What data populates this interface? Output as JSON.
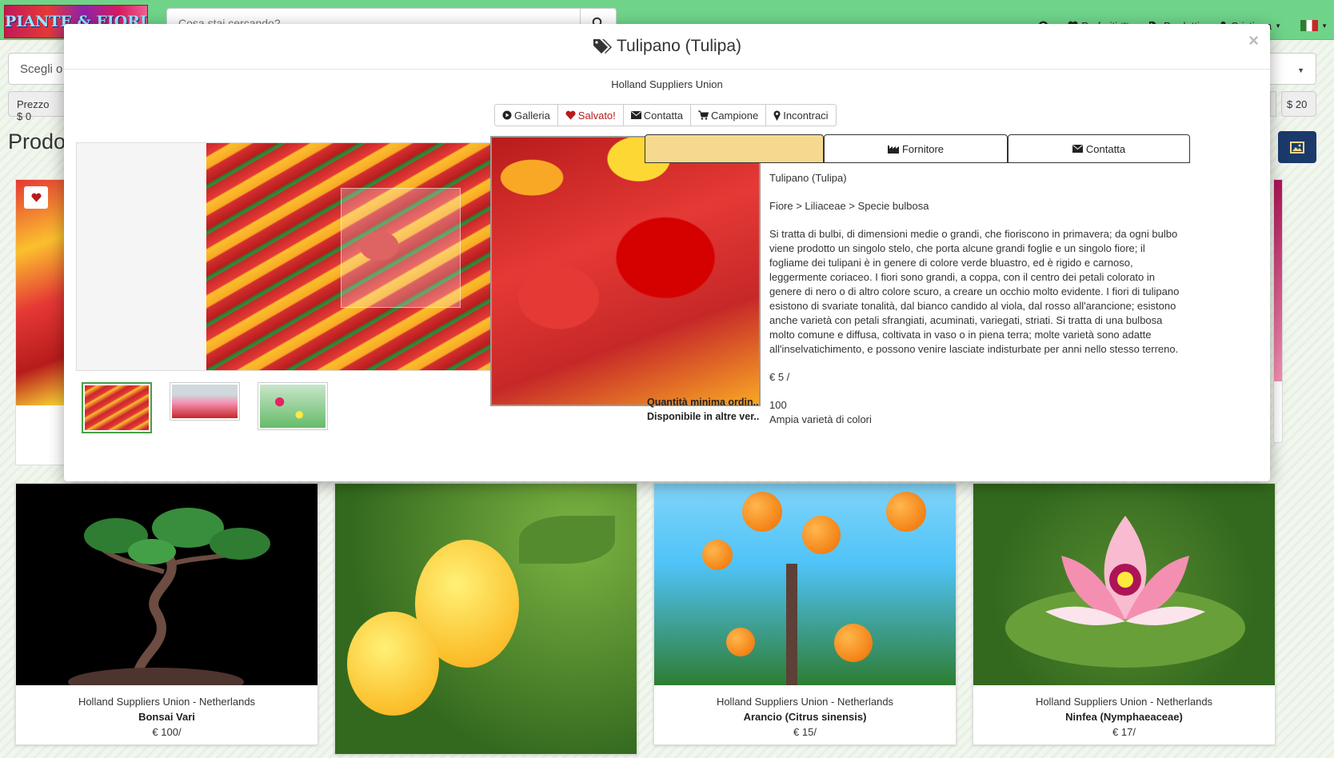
{
  "navbar": {
    "logo_text": "PIANTE & FIORI",
    "search_placeholder": "Cosa stai cercando?",
    "links": {
      "favorites": "Preferiti",
      "favorites_count": "(3)",
      "products": "Prodotti",
      "user": "Cristiana"
    }
  },
  "page": {
    "category_select": "Scegli o",
    "price_filter_left": "Prezzo $ 0",
    "price_filter_right": "$ 20",
    "heading": "Prodo"
  },
  "cards": [
    {
      "supplier": "Holland Suppliers Union - Netherlands",
      "name": "Bonsai Vari",
      "price": "€ 100/"
    },
    {
      "supplier": "",
      "name": "",
      "price": ""
    },
    {
      "supplier": "Holland Suppliers Union - Netherlands",
      "name": "Arancio (Citrus sinensis)",
      "price": "€ 15/"
    },
    {
      "supplier": "Holland Suppliers Union - Netherlands",
      "name": "Ninfea (Nymphaeaceae)",
      "price": "€ 17/"
    }
  ],
  "modal": {
    "title": "Tulipano (Tulipa)",
    "supplier": "Holland Suppliers Union",
    "close": "×",
    "buttons": {
      "gallery": "Galleria",
      "saved": "Salvato!",
      "contact": "Contatta",
      "sample": "Campione",
      "meet": "Incontraci"
    },
    "tabs": {
      "supplier": "Fornitore",
      "contact": "Contatta"
    },
    "details": {
      "name": "Tulipano (Tulipa)",
      "category": "Fiore > Liliaceae > Specie bulbosa",
      "description": "Si tratta di bulbi, di dimensioni medie o grandi, che fioriscono in primavera; da ogni bulbo viene prodotto un singolo stelo, che porta alcune grandi foglie e un singolo fiore; il fogliame dei tulipani è in genere di colore verde bluastro, ed è rigido e carnoso, leggermente coriaceo. I fiori sono grandi, a coppa, con il centro dei petali colorato in genere di nero o di altro colore scuro, a creare un occhio molto evidente. I fiori di tulipano esistono di svariate tonalità, dal bianco candido al viola, dal rosso all'arancione; esistono anche varietà con petali sfrangiati, acuminati, variegati, striati. Si tratta di una bulbosa molto comune e diffusa, coltivata in vaso o in piena terra; molte varietà sono adatte all'inselvatichimento, e possono venire lasciate indisturbate per anni nello stesso terreno.",
      "price": "€ 5 /",
      "min_quantity_label": "Quantità minima ordin...",
      "min_quantity": "100",
      "other_versions_label": "Disponibile in altre ver...",
      "other_versions": "Ampia varietà di colori"
    }
  },
  "colors": {
    "navbar": "#6fd48a",
    "active_tab": "#f6d98e",
    "saved": "#b71c1c",
    "image_button": "#1b3a6b"
  }
}
